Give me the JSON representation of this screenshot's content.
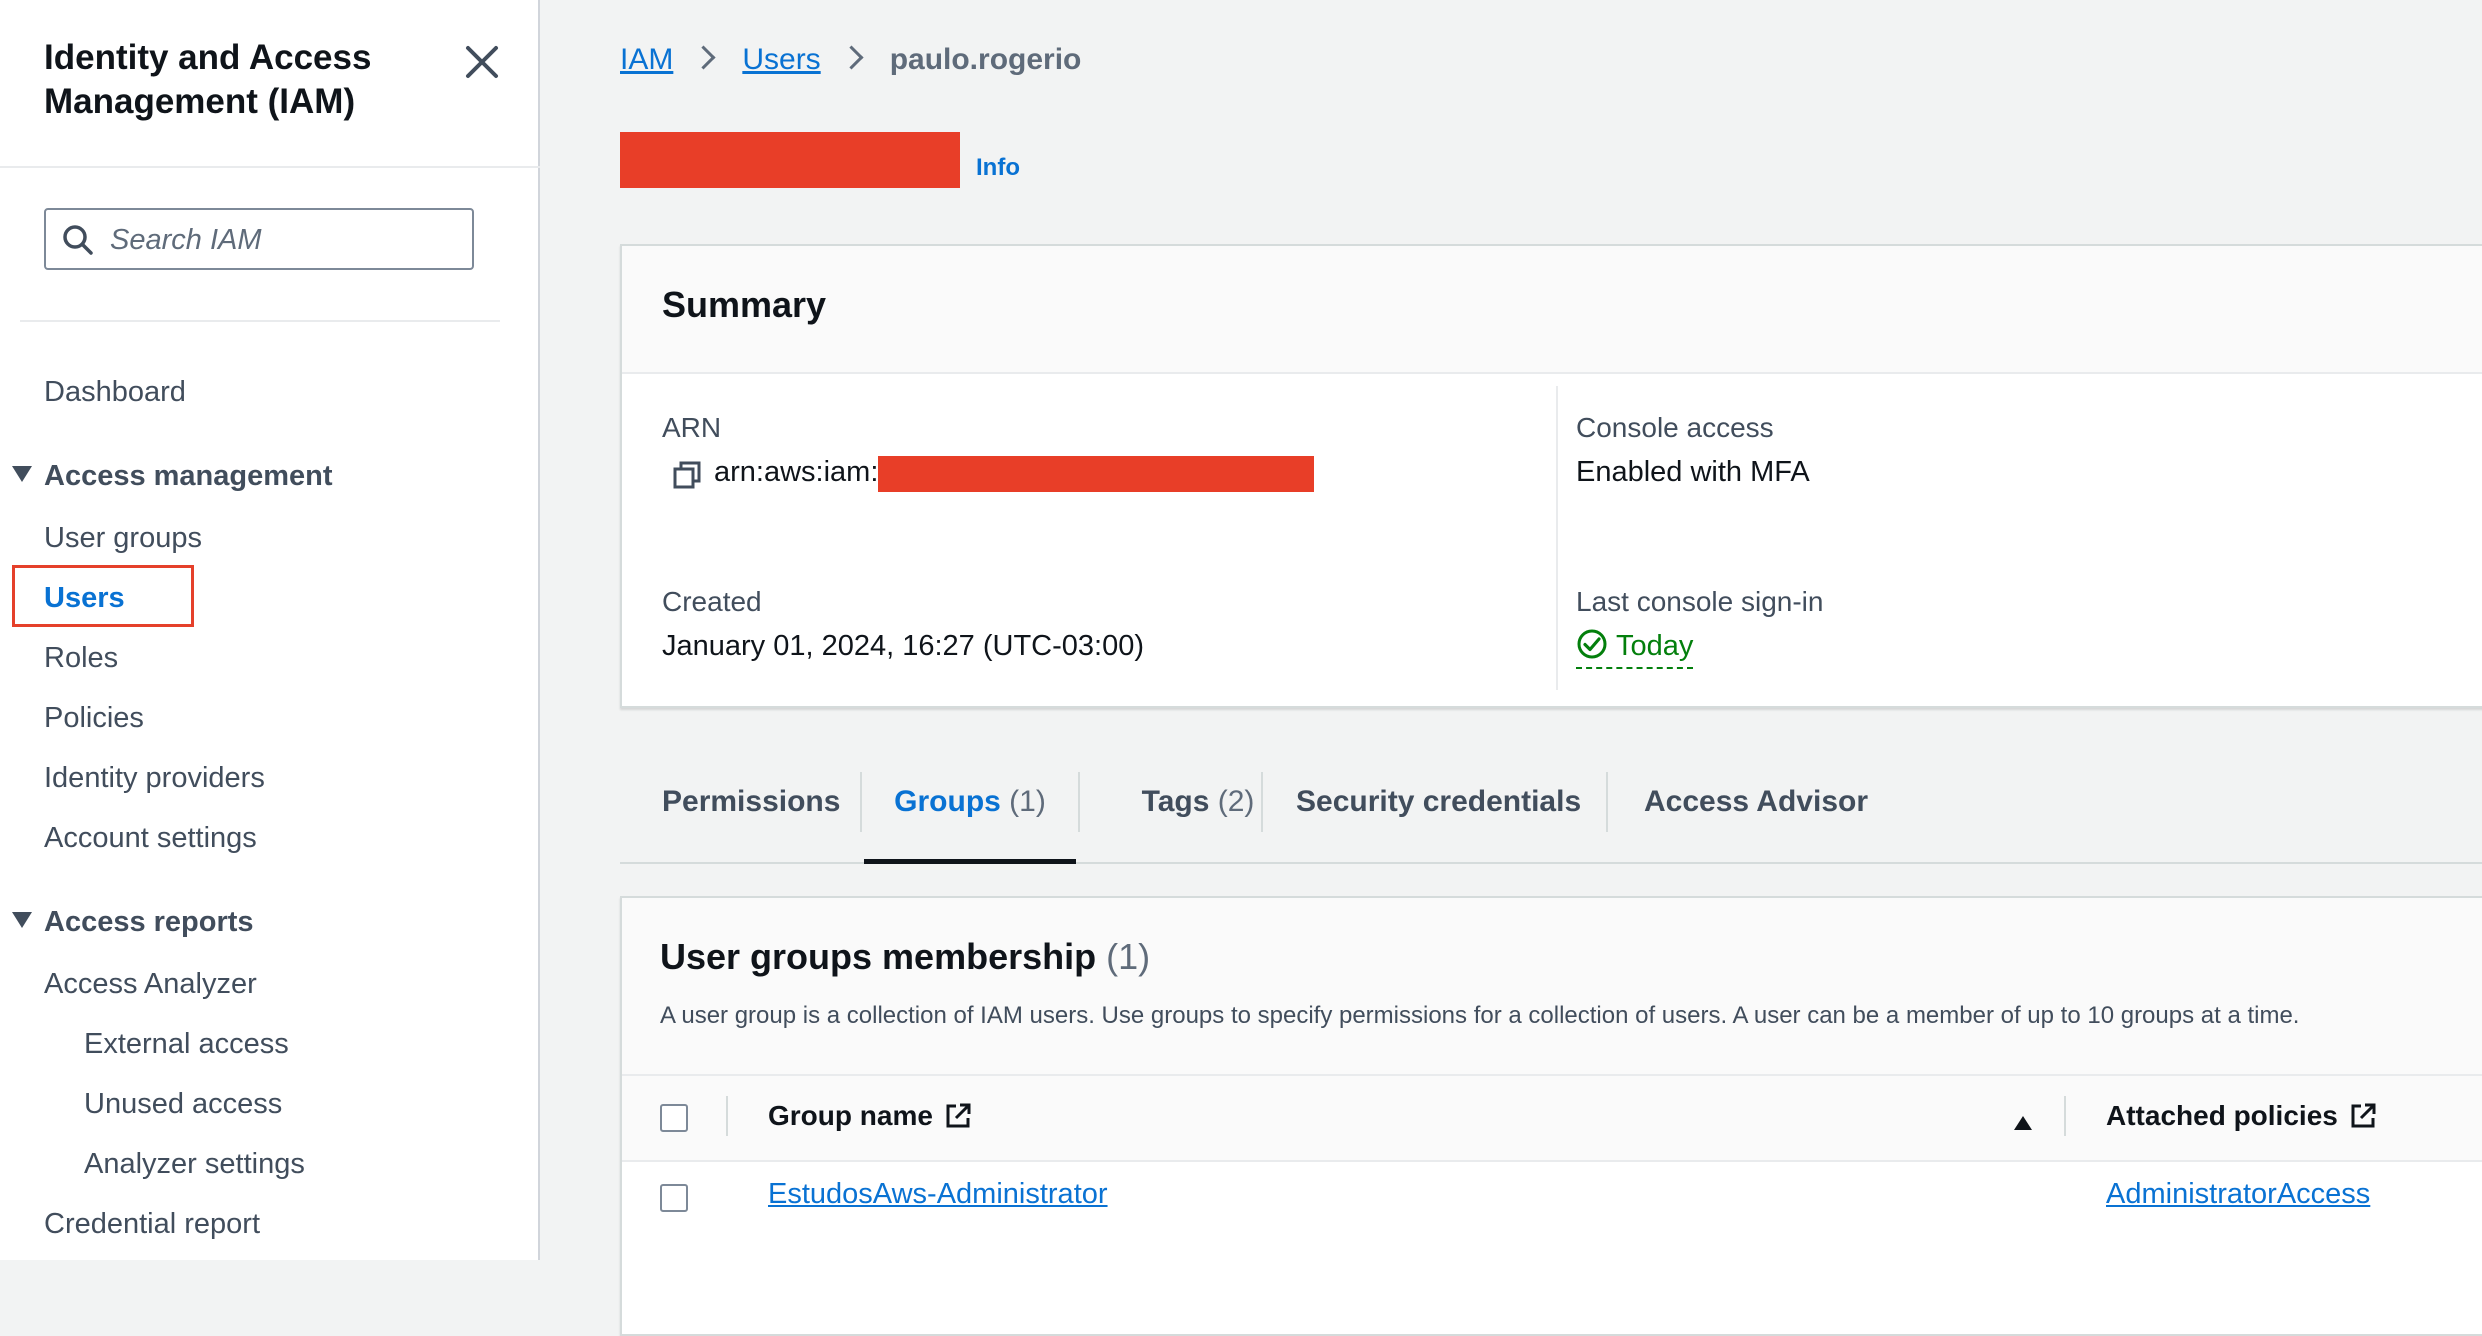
{
  "sidebar": {
    "title": "Identity and Access Management (IAM)",
    "search_placeholder": "Search IAM",
    "dashboard": "Dashboard",
    "access_management": {
      "label": "Access management",
      "items": [
        "User groups",
        "Users",
        "Roles",
        "Policies",
        "Identity providers",
        "Account settings"
      ]
    },
    "access_reports": {
      "label": "Access reports",
      "analyzer": "Access Analyzer",
      "analyzer_items": [
        "External access",
        "Unused access",
        "Analyzer settings"
      ],
      "credential_report": "Credential report"
    },
    "active_item": "Users",
    "highlight_color": "#e5402a"
  },
  "breadcrumb": {
    "items": [
      "IAM",
      "Users"
    ],
    "current": "paulo.rogerio"
  },
  "header": {
    "info_label": "Info",
    "redaction_color": "#e83e28"
  },
  "summary": {
    "title": "Summary",
    "arn_label": "ARN",
    "arn_value": "arn:aws:iam::",
    "created_label": "Created",
    "created_value": "January 01, 2024, 16:27 (UTC-03:00)",
    "console_access_label": "Console access",
    "console_access_value": "Enabled with MFA",
    "last_signin_label": "Last console sign-in",
    "last_signin_value": "Today"
  },
  "tabs": [
    {
      "label": "Permissions",
      "count": ""
    },
    {
      "label": "Groups",
      "count": "(1)"
    },
    {
      "label": "Tags",
      "count": "(2)"
    },
    {
      "label": "Security credentials",
      "count": ""
    },
    {
      "label": "Access Advisor",
      "count": ""
    }
  ],
  "active_tab": "Groups",
  "groups": {
    "title": "User groups membership",
    "count": "(1)",
    "description": "A user group is a collection of IAM users. Use groups to specify permissions for a collection of users. A user can be a member of up to 10 groups at a time.",
    "columns": [
      "Group name",
      "Attached policies"
    ],
    "rows": [
      {
        "group_name": "EstudosAws-Administrator",
        "attached_policies": "AdministratorAccess"
      }
    ]
  },
  "colors": {
    "link": "#0972d3",
    "success": "#037f0c",
    "text": "#0f141a"
  }
}
